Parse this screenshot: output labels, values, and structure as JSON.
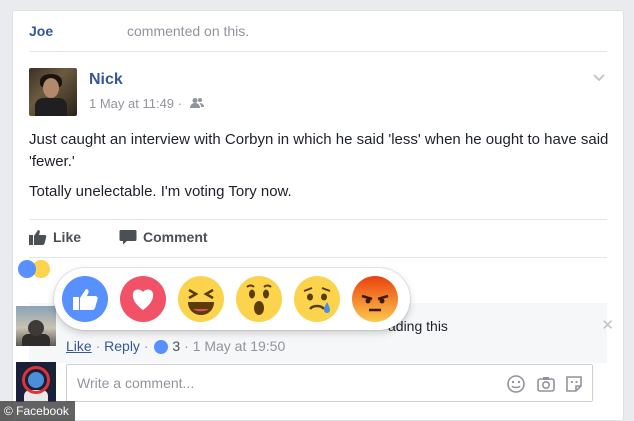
{
  "notification": {
    "user": "Joe",
    "text": "commented on this."
  },
  "post": {
    "author": "Nick",
    "timestamp": "1 May at 11:49 ·",
    "audience_icon": "friends-icon",
    "paragraphs": [
      "Just caught an interview with Corbyn in which he said 'less' when he ought to have said 'fewer.'",
      "Totally unelectable. I'm voting Tory now."
    ]
  },
  "actions": {
    "like_label": "Like",
    "comment_label": "Comment"
  },
  "reactions": [
    "like",
    "love",
    "haha",
    "wow",
    "sad",
    "angry"
  ],
  "comment": {
    "text_fragment": "ading this",
    "like_link": "Like",
    "reply_link": "Reply",
    "like_count": "3",
    "separator": "·",
    "time": "1 May at 19:50"
  },
  "composer": {
    "placeholder": "Write a comment..."
  },
  "watermark": "© Facebook",
  "colors": {
    "link": "#365899",
    "like_blue": "#5890ff",
    "love_red": "#f25268",
    "angry_red": "#e9710f"
  }
}
